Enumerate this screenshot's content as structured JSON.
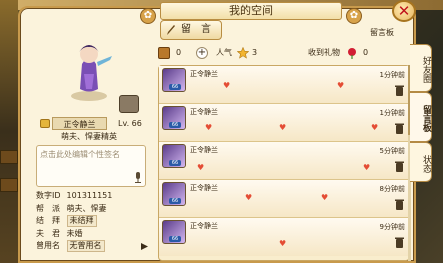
{
  "window": {
    "title": "我的空间",
    "close_label": "✕"
  },
  "profile": {
    "name": "正令静兰",
    "level": "Lv. 66",
    "title": "萌夫、悍妻精英",
    "signature_placeholder": "点击此处编辑个性签名",
    "info": [
      {
        "key": "数字ID",
        "value": "101311151"
      },
      {
        "key": "帮　派",
        "value": "萌夫、悍妻"
      },
      {
        "key": "结　拜",
        "value": "未结拜"
      },
      {
        "key": "夫　君",
        "value": "未婚"
      },
      {
        "key": "曾用名",
        "value": "无曾用名"
      }
    ]
  },
  "toolbar": {
    "leave_message_label": "留　言",
    "board_label": "留言板"
  },
  "stats": {
    "treasure_count": "0",
    "popularity_label": "人气",
    "popularity_value": "3",
    "gifts_label": "收到礼物",
    "gifts_value": "0"
  },
  "messages": [
    {
      "name": "正令静兰",
      "time": "1分钟前",
      "level": "66"
    },
    {
      "name": "正令静兰",
      "time": "1分钟前",
      "level": "66"
    },
    {
      "name": "正令静兰",
      "time": "5分钟前",
      "level": "66"
    },
    {
      "name": "正令静兰",
      "time": "8分钟前",
      "level": "66"
    },
    {
      "name": "正令静兰",
      "time": "9分钟前",
      "level": "66"
    }
  ],
  "side_tabs": {
    "friends": "好友圈",
    "board": "留言板",
    "status": "状态"
  },
  "colors": {
    "panel_bg": "#fbf3dc",
    "border_gold": "#c89a4c",
    "close_red": "#c0141c",
    "heart_red": "#e44d35"
  }
}
